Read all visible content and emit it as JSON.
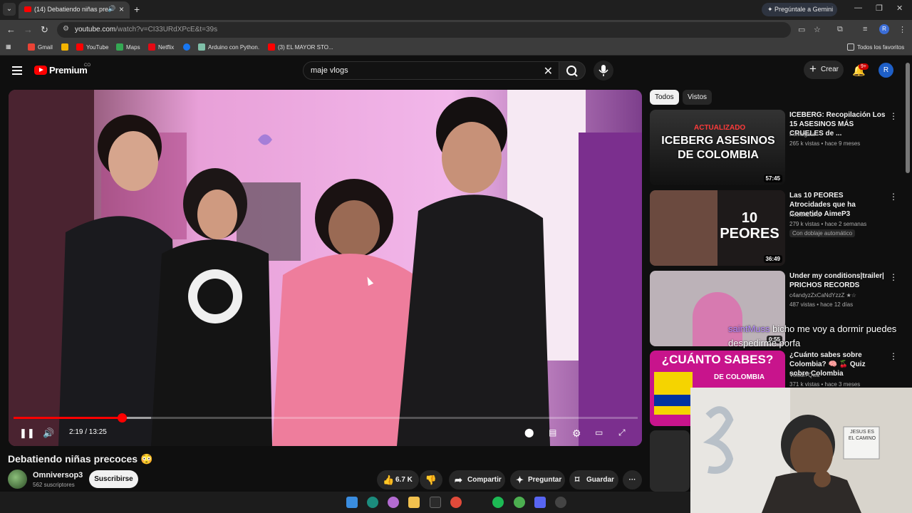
{
  "browser": {
    "tab_title": "(14) Debatiendo niñas precoces - YouTube",
    "gemini_label": "Pregúntale a Gemini",
    "url_host": "youtube.com",
    "url_path": "/watch?v=CI33URdXPcE&t=39s",
    "profile_initial": "R"
  },
  "bookmarks": [
    {
      "label": "Gmail",
      "color": "#ea4335"
    },
    {
      "label": "YouTube",
      "color": "#ff0000"
    },
    {
      "label": "Maps",
      "color": "#34a853"
    },
    {
      "label": "Netflix",
      "color": "#e50914"
    },
    {
      "label": "",
      "color": "#1877f2"
    },
    {
      "label": "Arduino con Python.",
      "color": "#7fbfa8"
    },
    {
      "label": "(3) EL MAYOR STO...",
      "color": "#ff0000"
    }
  ],
  "bookmarks_all": "Todos los favoritos",
  "yt": {
    "brand": "Premium",
    "country": "CO",
    "search_query": "maje vlogs",
    "create_label": "Crear",
    "notif_count": "9+",
    "avatar_initial": "R"
  },
  "player": {
    "time": "2:19 / 13:25",
    "progress_fraction": 0.173,
    "buffered_fraction": 0.22
  },
  "video": {
    "title": "Debatiendo niñas precoces 😳",
    "channel": "Omniversop3",
    "subscribers": "562 suscriptores",
    "subscribe_label": "Suscribirse",
    "likes": "6.7 K",
    "share_label": "Compartir",
    "ask_label": "Preguntar",
    "save_label": "Guardar"
  },
  "chips": [
    "Todos",
    "Vistos"
  ],
  "related": [
    {
      "title": "ICEBERG: Recopilación Los 15 ASESINOS MÁS CRUELES de ...",
      "channel": "Fomagata",
      "meta": "265 k vistas • hace 9 meses",
      "duration": "57:45",
      "thumb_text": "ICEBERG ASESINOS DE COLOMBIA",
      "thumb_top": "ACTUALIZADO"
    },
    {
      "title": "Las 10 PEORES Atrocidades que ha Cometido AimeP3",
      "channel": "RobertLGA2",
      "meta": "279 k vistas • hace 2 semanas",
      "duration": "36:49",
      "badge": "Con doblaje automático",
      "thumb_text": "10 PEORES"
    },
    {
      "title": "Under my conditions|trailer| PRICHOS RECORDS",
      "channel": "c4andyzZxCaNdYzzZ ★☆",
      "meta": "487 vistas • hace 12 días",
      "duration": "0:55"
    },
    {
      "title": "¿Cuánto sabes sobre Colombia? 🧠 🍒 Quiz sobre Colombia",
      "channel": "Volcan Quiz",
      "meta": "371 k vistas • hace 3 meses",
      "thumb_text": "¿CUÁNTO SABES?",
      "thumb_sub": "DE COLOMBIA"
    }
  ],
  "chat_overlay": {
    "user": "saintMuss",
    "message": "bicho me voy a dormir puedes despedirme porfa"
  },
  "webcam": {
    "sign_text": "JESUS ES EL CAMINO"
  },
  "colors": {
    "accent": "#ff0000",
    "background": "#0f0f0f",
    "chip_active": "#f1f1f1"
  }
}
